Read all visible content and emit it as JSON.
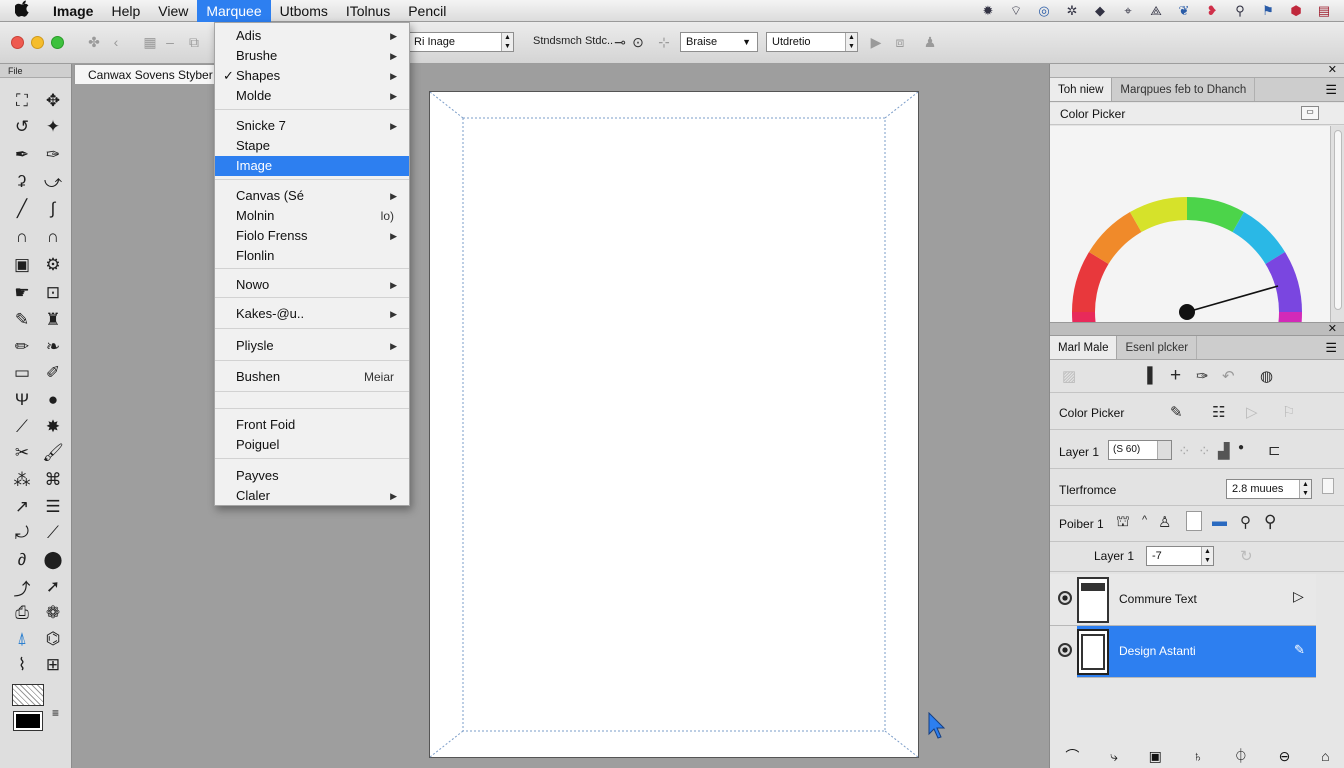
{
  "menubar": {
    "items": [
      "Image",
      "Help",
      "View",
      "Marquee",
      "Utboms",
      "ITolnus",
      "Pencil"
    ],
    "active_index": 3,
    "status_icons": [
      "gear-icon",
      "wifi-icon",
      "target-icon",
      "bug-icon",
      "tag-icon",
      "pin-icon",
      "triangle-icon",
      "bird-icon",
      "heart-icon",
      "search-icon",
      "flag-icon",
      "badge-icon",
      "document-icon"
    ]
  },
  "toolbar": {
    "size_field": "Ri Inage",
    "brush_label": "Stndsmch Stdc..",
    "brush_select": "Braise",
    "mode_field": "Utdretio"
  },
  "document": {
    "tab_title": "Canwax Sovens Styber"
  },
  "left_panel": {
    "header": "File"
  },
  "menu": {
    "items": [
      {
        "label": "Adis",
        "arrow": true,
        "checked": false,
        "selected": false,
        "faded": false,
        "shortcut": ""
      },
      {
        "label": "Brushe",
        "arrow": true,
        "checked": false,
        "selected": false,
        "faded": false,
        "shortcut": ""
      },
      {
        "label": "Shapes",
        "arrow": true,
        "checked": true,
        "selected": false,
        "faded": false,
        "shortcut": ""
      },
      {
        "label": "Molde",
        "arrow": true,
        "checked": false,
        "selected": false,
        "faded": false,
        "shortcut": ""
      },
      {
        "label": "Snicke 7",
        "arrow": true,
        "checked": false,
        "selected": false,
        "faded": false,
        "shortcut": ""
      },
      {
        "label": "Stape",
        "arrow": false,
        "checked": false,
        "selected": false,
        "faded": false,
        "shortcut": ""
      },
      {
        "label": "Image",
        "arrow": false,
        "checked": false,
        "selected": true,
        "faded": false,
        "shortcut": ""
      },
      {
        "label": "Canvas (Sé",
        "arrow": true,
        "checked": false,
        "selected": false,
        "faded": false,
        "shortcut": ""
      },
      {
        "label": "Molnin",
        "arrow": false,
        "checked": false,
        "selected": false,
        "faded": false,
        "shortcut": "lo)"
      },
      {
        "label": "Fiolo Frenss",
        "arrow": true,
        "checked": false,
        "selected": false,
        "faded": false,
        "shortcut": ""
      },
      {
        "label": "Flonlin",
        "arrow": false,
        "checked": false,
        "selected": false,
        "faded": false,
        "shortcut": ""
      },
      {
        "label": "Nowo",
        "arrow": true,
        "checked": false,
        "selected": false,
        "faded": false,
        "shortcut": ""
      },
      {
        "label": "Kakes-@u..",
        "arrow": true,
        "checked": false,
        "selected": false,
        "faded": false,
        "shortcut": ""
      },
      {
        "label": "Pliysle",
        "arrow": true,
        "checked": false,
        "selected": false,
        "faded": false,
        "shortcut": ""
      },
      {
        "label": "Bushen",
        "arrow": false,
        "checked": false,
        "selected": false,
        "faded": false,
        "shortcut": "Meiar"
      },
      {
        "label": "Front Foid",
        "arrow": false,
        "checked": false,
        "selected": false,
        "faded": false,
        "shortcut": ""
      },
      {
        "label": "Poiguel",
        "arrow": false,
        "checked": false,
        "selected": false,
        "faded": false,
        "shortcut": ""
      },
      {
        "label": "Payves",
        "arrow": false,
        "checked": false,
        "selected": false,
        "faded": false,
        "shortcut": ""
      },
      {
        "label": "Claler",
        "arrow": true,
        "checked": false,
        "selected": false,
        "faded": false,
        "shortcut": ""
      }
    ]
  },
  "right_panel": {
    "top_tabs": [
      "Toh niew",
      "Marqpues feb to Dhanch"
    ],
    "color_picker_title": "Color Picker",
    "bottom_tabs": [
      "Marl Male",
      "Esenl plcker"
    ],
    "rows": {
      "color_picker": "Color Picker",
      "layer1_label": "Layer 1",
      "layer1_value": "(S 60)",
      "performance_label": "Tlerfromce",
      "performance_value": "2.8 muues",
      "porber_label": "Poiber 1",
      "layer_label2": "Layer 1",
      "layer_value2": "-7"
    },
    "layers": [
      {
        "name": "Commure Text",
        "selected": false
      },
      {
        "name": "Design Astanti",
        "selected": true
      }
    ],
    "accent_color": "#2d7ff0"
  }
}
